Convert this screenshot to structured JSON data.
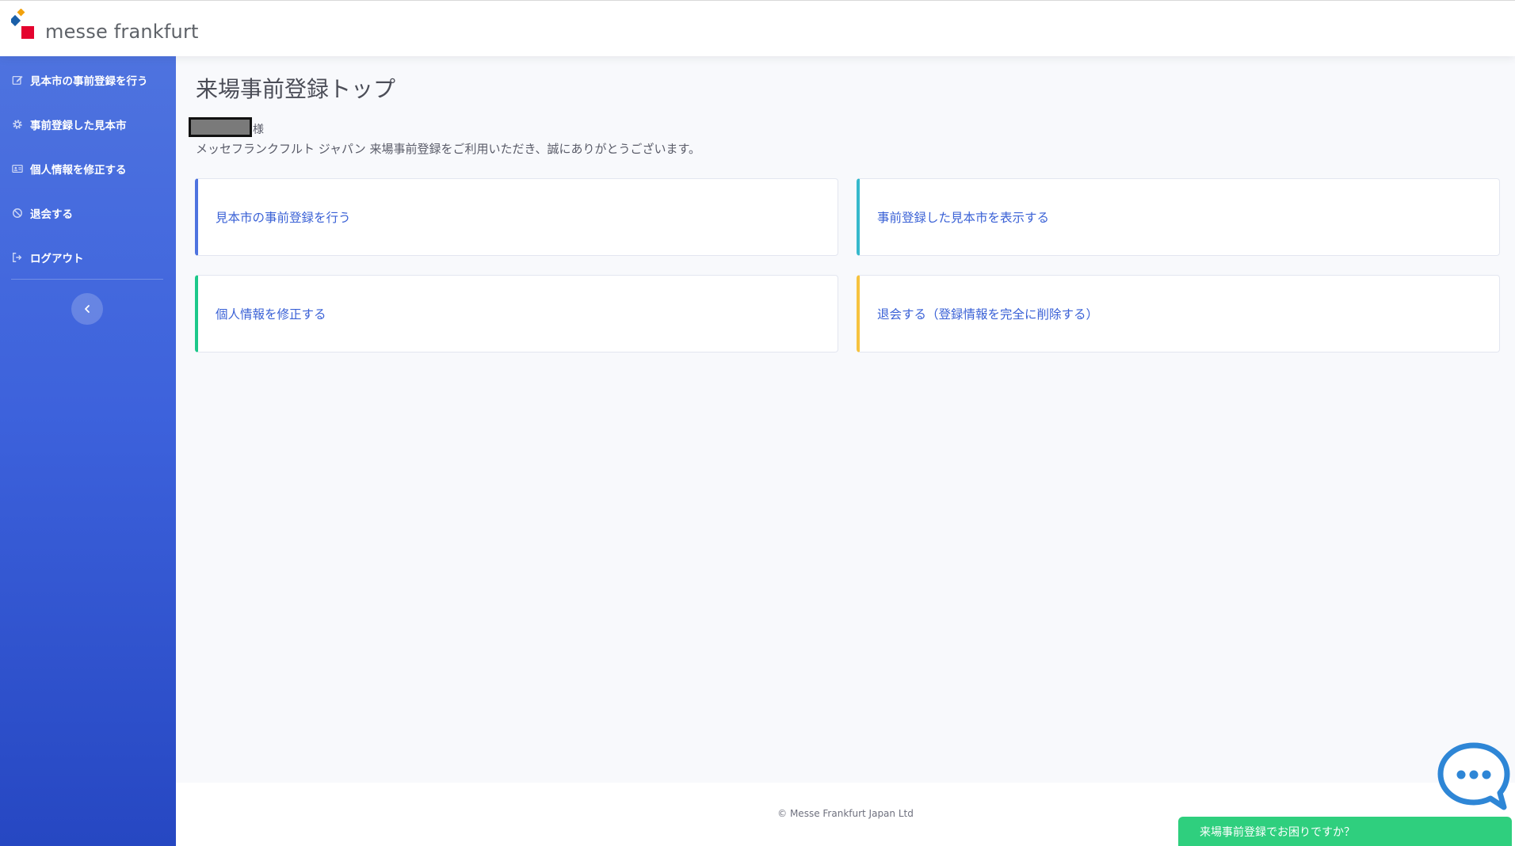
{
  "header": {
    "brand": "messe frankfurt",
    "logo_colors": [
      "#1a5fa8",
      "#f2a20c",
      "#e4032e"
    ]
  },
  "sidebar": {
    "items": [
      {
        "label": "見本市の事前登録を行う",
        "icon": "edit-icon"
      },
      {
        "label": "事前登録した見本市",
        "icon": "gear-icon"
      },
      {
        "label": "個人情報を修正する",
        "icon": "id-card-icon"
      },
      {
        "label": "退会する",
        "icon": "ban-icon"
      },
      {
        "label": "ログアウト",
        "icon": "sign-out-icon"
      }
    ],
    "toggle_icon": "chevron-left-icon"
  },
  "main": {
    "title": "来場事前登録トップ",
    "honorific": "様",
    "greeting": "メッセフランクフルト ジャパン 来場事前登録をご利用いただき、誠にありがとうございます。",
    "cards": [
      {
        "label": "見本市の事前登録を行う",
        "accent": "#4e73df"
      },
      {
        "label": "事前登録した見本市を表示する",
        "accent": "#36b9cc"
      },
      {
        "label": "個人情報を修正する",
        "accent": "#1cc88a"
      },
      {
        "label": "退会する（登録情報を完全に削除する）",
        "accent": "#f6c23e"
      }
    ]
  },
  "footer": {
    "copyright": "© Messe Frankfurt Japan Ltd"
  },
  "chat": {
    "icon": "chat-bubble-icon",
    "help_text": "来場事前登録でお困りですか？",
    "color": "#2fcf7e"
  }
}
